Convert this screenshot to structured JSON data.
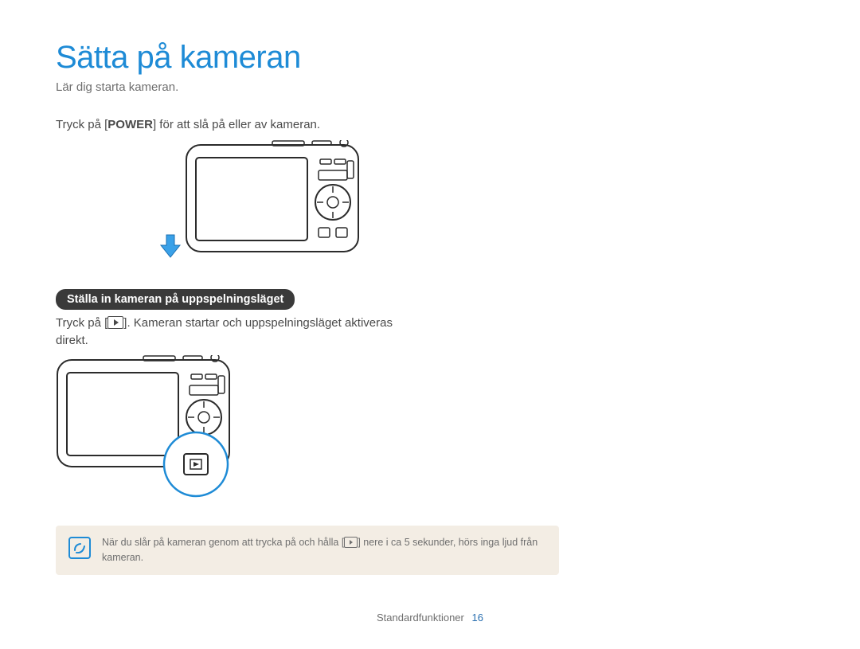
{
  "title": "Sätta på kameran",
  "subtitle": "Lär dig starta kameran.",
  "instruction": {
    "pre": "Tryck på [",
    "bold": "POWER",
    "post": "] för att slå på eller av kameran."
  },
  "section_pill": "Ställa in kameran på uppspelningsläget",
  "playback": {
    "line1_pre": "Tryck på [",
    "line1_post": "]. Kameran startar och uppspelningsläget aktiveras",
    "line2": "direkt."
  },
  "note": {
    "part1": "När du slår på kameran genom att trycka på och hålla [",
    "part2": "] nere i ca 5 sekunder, hörs inga ljud från kameran."
  },
  "footer": {
    "section": "Standardfunktioner",
    "page": "16"
  }
}
